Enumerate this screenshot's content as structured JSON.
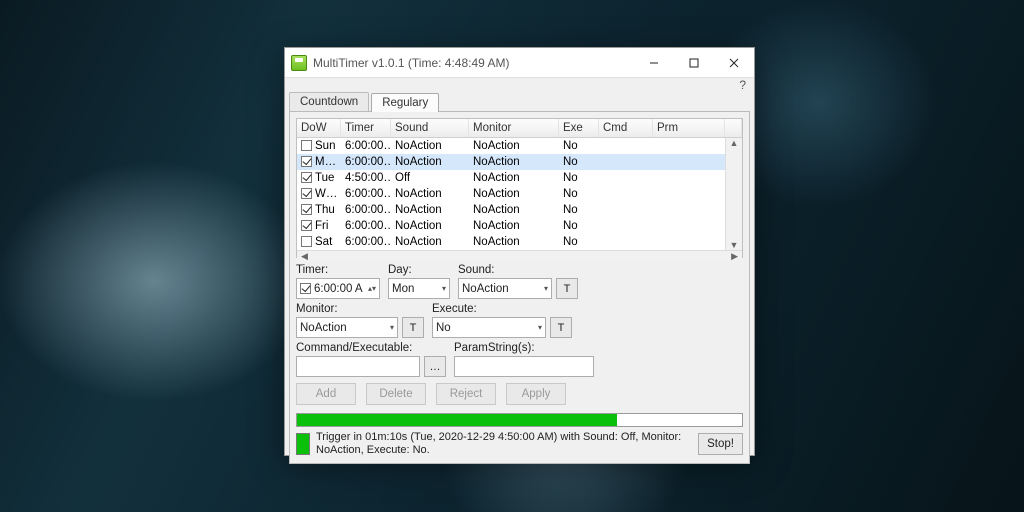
{
  "window": {
    "title": "MultiTimer v1.0.1 (Time: 4:48:49 AM)",
    "help": "?"
  },
  "tabs": {
    "countdown": "Countdown",
    "regulary": "Regulary"
  },
  "list": {
    "headers": {
      "dow": "DoW",
      "timer": "Timer",
      "sound": "Sound",
      "monitor": "Monitor",
      "exe": "Exe",
      "cmd": "Cmd",
      "prm": "Prm"
    },
    "rows": [
      {
        "checked": false,
        "dow": "Sun",
        "timer": "6:00:00…",
        "sound": "NoAction",
        "monitor": "NoAction",
        "exe": "No",
        "cmd": "",
        "prm": "",
        "sel": false
      },
      {
        "checked": true,
        "dow": "M…",
        "timer": "6:00:00…",
        "sound": "NoAction",
        "monitor": "NoAction",
        "exe": "No",
        "cmd": "",
        "prm": "",
        "sel": true
      },
      {
        "checked": true,
        "dow": "Tue",
        "timer": "4:50:00…",
        "sound": "Off",
        "monitor": "NoAction",
        "exe": "No",
        "cmd": "",
        "prm": "",
        "sel": false
      },
      {
        "checked": true,
        "dow": "W…",
        "timer": "6:00:00…",
        "sound": "NoAction",
        "monitor": "NoAction",
        "exe": "No",
        "cmd": "",
        "prm": "",
        "sel": false
      },
      {
        "checked": true,
        "dow": "Thu",
        "timer": "6:00:00…",
        "sound": "NoAction",
        "monitor": "NoAction",
        "exe": "No",
        "cmd": "",
        "prm": "",
        "sel": false
      },
      {
        "checked": true,
        "dow": "Fri",
        "timer": "6:00:00…",
        "sound": "NoAction",
        "monitor": "NoAction",
        "exe": "No",
        "cmd": "",
        "prm": "",
        "sel": false
      },
      {
        "checked": false,
        "dow": "Sat",
        "timer": "6:00:00…",
        "sound": "NoAction",
        "monitor": "NoAction",
        "exe": "No",
        "cmd": "",
        "prm": "",
        "sel": false
      }
    ]
  },
  "form": {
    "timer": {
      "label": "Timer:",
      "value": "6:00:00 A",
      "checked": true
    },
    "day": {
      "label": "Day:",
      "value": "Mon"
    },
    "sound": {
      "label": "Sound:",
      "value": "NoAction",
      "btn": "T"
    },
    "monitor": {
      "label": "Monitor:",
      "value": "NoAction",
      "btn": "T"
    },
    "execute": {
      "label": "Execute:",
      "value": "No",
      "btn": "T"
    },
    "cmd": {
      "label": "Command/Executable:",
      "value": "",
      "btn": "…"
    },
    "param": {
      "label": "ParamString(s):",
      "value": ""
    }
  },
  "buttons": {
    "add": "Add",
    "delete": "Delete",
    "reject": "Reject",
    "apply": "Apply"
  },
  "progress": {
    "pct": 72
  },
  "status": {
    "text": "Trigger in 01m:10s (Tue, 2020-12-29 4:50:00 AM) with Sound: Off, Monitor: NoAction, Execute: No.",
    "stop": "Stop!"
  }
}
